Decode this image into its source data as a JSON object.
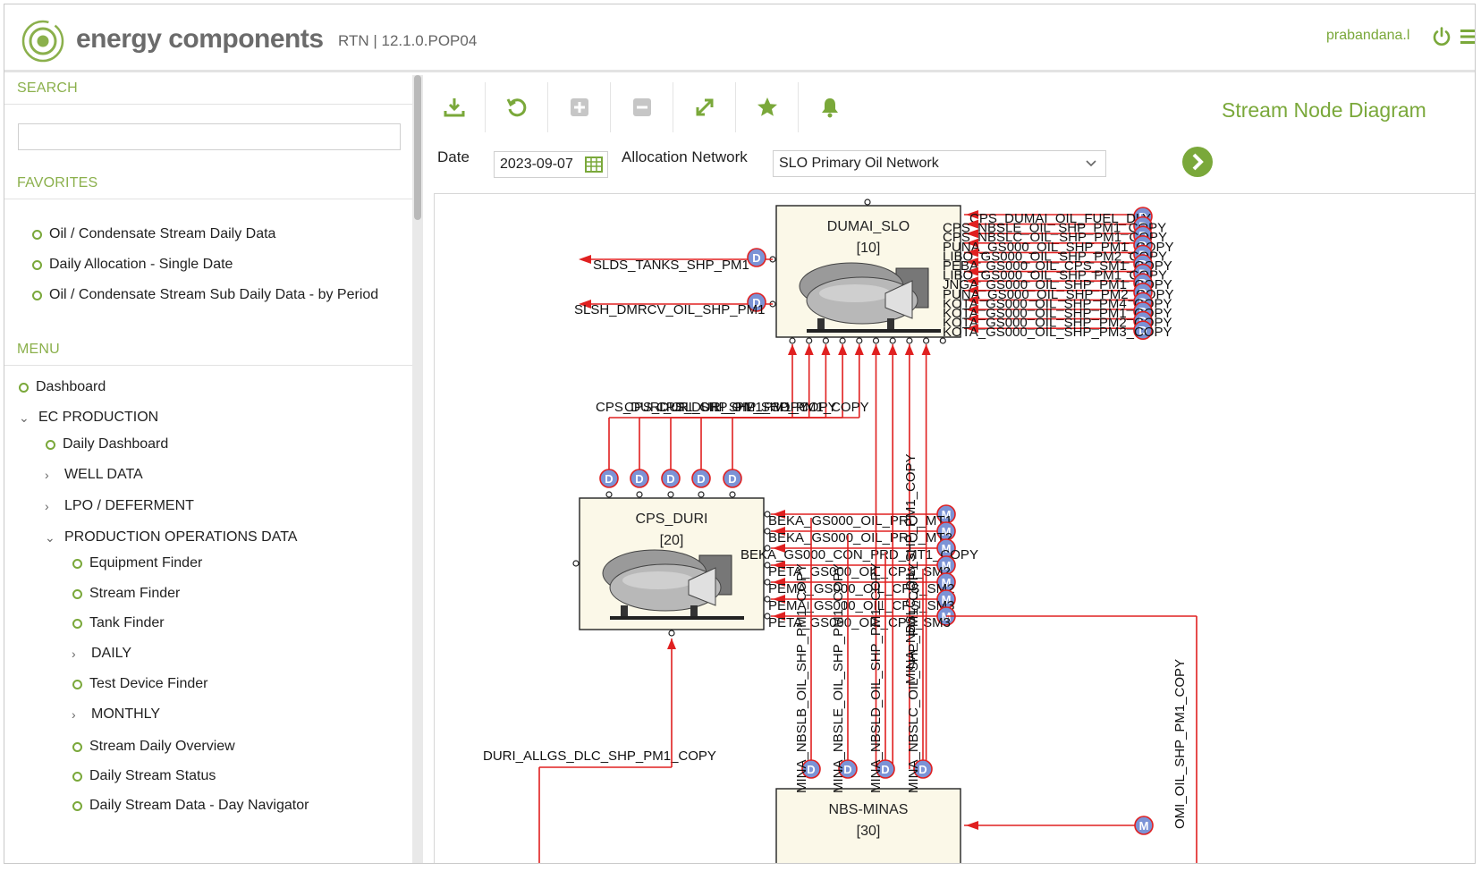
{
  "header": {
    "brand": "energy components",
    "version": "RTN | 12.1.0.POP04",
    "user": "prabandana.l"
  },
  "sidebar": {
    "search_title": "SEARCH",
    "search_value": "",
    "favorites_title": "FAVORITES",
    "favorites": [
      {
        "label": "Oil / Condensate Stream Daily Data"
      },
      {
        "label": "Daily Allocation - Single Date"
      },
      {
        "label": "Oil / Condensate Stream Sub Daily Data - by Period"
      }
    ],
    "menu_title": "MENU",
    "menu": [
      {
        "label": "Dashboard",
        "kind": "bullet"
      },
      {
        "label": "EC PRODUCTION",
        "kind": "expanded"
      },
      {
        "label": "Daily Dashboard",
        "kind": "bullet"
      },
      {
        "label": "WELL DATA",
        "kind": "collapsed"
      },
      {
        "label": "LPO / DEFERMENT",
        "kind": "collapsed"
      },
      {
        "label": "PRODUCTION OPERATIONS DATA",
        "kind": "expanded"
      },
      {
        "label": "Equipment Finder",
        "kind": "bullet"
      },
      {
        "label": "Stream Finder",
        "kind": "bullet"
      },
      {
        "label": "Tank Finder",
        "kind": "bullet"
      },
      {
        "label": "DAILY",
        "kind": "collapsed"
      },
      {
        "label": "Test Device Finder",
        "kind": "bullet"
      },
      {
        "label": "MONTHLY",
        "kind": "collapsed"
      },
      {
        "label": "Stream Daily Overview",
        "kind": "bullet"
      },
      {
        "label": "Daily Stream Status",
        "kind": "bullet"
      },
      {
        "label": "Daily Stream Data - Day Navigator",
        "kind": "bullet"
      }
    ]
  },
  "toolbar": {
    "icons": [
      "download-icon",
      "refresh-icon",
      "zoom-in-icon",
      "zoom-out-icon",
      "fit-icon",
      "star-icon",
      "bell-icon"
    ]
  },
  "main": {
    "page_title": "Stream Node Diagram",
    "date_label": "Date",
    "date_value": "2023-09-07",
    "network_label": "Allocation Network",
    "network_value": "SLO Primary Oil Network"
  },
  "diagram": {
    "nodes": {
      "dumai": {
        "name": "DUMAI_SLO",
        "id": "[10]"
      },
      "cps": {
        "name": "CPS_DURI",
        "id": "[20]"
      },
      "nbs": {
        "name": "NBS-MINAS",
        "id": "[30]"
      }
    },
    "dumai_outputs": [
      "SLDS_TANKS_SHP_PM1",
      "SLSH_DMRCV_OIL_SHP_PM1"
    ],
    "dumai_inputs": [
      "CPS_DUMAI_OIL_FUEL_DLY",
      "CPS_NBSLE_OIL_SHP_PM1_COPY",
      "CPS_NBSLC_OIL_SHP_PM1_COPY",
      "PUNA_GS000_OIL_SHP_PM1_COPY",
      "LIBO_GS000_OIL_SHP_PM2_COPY",
      "PEBA_GS000_OIL_CPS_SM1_COPY",
      "LIBO_GS000_OIL_SHP_PM1_COPY",
      "JNGA_GS000_OIL_SHP_PM1_COPY",
      "PUNA_GS000_OIL_SHP_PM2_COPY",
      "KOTA_GS000_OIL_SHP_PM4_COPY",
      "KOTA_GS000_OIL_SHP_PM1_COPY",
      "KOTA_GS000_OIL_SHP_PM2_COPY",
      "KOTA_GS000_OIL_SHP_PM3_COPY"
    ],
    "cps_up_label": "CPS_DURI_OIL_SHP_PM1_COPY",
    "cps_inputs": [
      "BEKA_GS000_OIL_PRD_MT1",
      "BEKA_GS000_OIL_PRD_MT2",
      "BEKA_GS000_CON_PRD_MT1_COPY",
      "PETA_GS000_OIL_CPS_SM2",
      "PEMA_GS000_OIL_CPS_SM2",
      "PEMA_GS000_OIL_CPS_SM3",
      "PETA_GS000_OIL_CPS_SM3"
    ],
    "nbs_vertical": [
      "MINA_NBSLB_OIL_SHP_PM1_COPY",
      "MINA_NBSLE_OIL_SHP_PM1_COPY",
      "MINA_NBSLD_OIL_SHP_PM1_COPY",
      "MINA_NBSLC_OIL_SHP_PM1_COPY"
    ],
    "right_vertical": "OMI_OIL_SHP_PM1_COPY",
    "duri_label": "DURI_ALLGS_DLC_SHP_PM1_COPY",
    "badge_d": "D",
    "badge_m": "M"
  },
  "colors": {
    "accent": "#7aa83a",
    "flow": "#e02020",
    "badge": "#7b93d6",
    "node_fill": "#fbf8e8"
  }
}
